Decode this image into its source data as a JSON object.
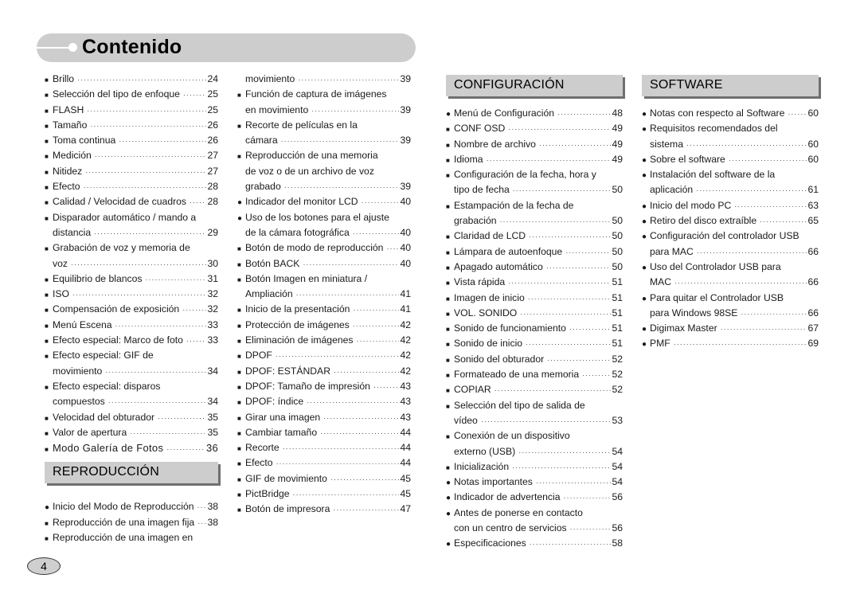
{
  "title": "Contenido",
  "page_number": "4",
  "column1": {
    "entries": [
      {
        "bullet": "square",
        "label": "Brillo",
        "page": "24"
      },
      {
        "bullet": "square",
        "label": "Selección del tipo de enfoque",
        "page": "25"
      },
      {
        "bullet": "square",
        "label": "FLASH",
        "page": "25"
      },
      {
        "bullet": "square",
        "label": "Tamaño",
        "page": "26"
      },
      {
        "bullet": "square",
        "label": "Toma continua",
        "page": "26"
      },
      {
        "bullet": "square",
        "label": "Medición",
        "page": "27"
      },
      {
        "bullet": "square",
        "label": "Nitidez",
        "page": "27"
      },
      {
        "bullet": "square",
        "label": "Efecto",
        "page": "28"
      },
      {
        "bullet": "square",
        "label": "Calidad / Velocidad de cuadros",
        "page": "28"
      },
      {
        "bullet": "square",
        "label": "Disparador automático / mando a",
        "page": ""
      },
      {
        "bullet": "",
        "label": "distancia",
        "page": "29"
      },
      {
        "bullet": "square",
        "label": "Grabación de voz y memoria de",
        "page": ""
      },
      {
        "bullet": "",
        "label": "voz",
        "page": "30"
      },
      {
        "bullet": "square",
        "label": "Equilibrio de blancos",
        "page": "31"
      },
      {
        "bullet": "square",
        "label": "ISO",
        "page": "32"
      },
      {
        "bullet": "square",
        "label": "Compensación de exposición",
        "page": "32"
      },
      {
        "bullet": "square",
        "label": "Menú Escena",
        "page": "33"
      },
      {
        "bullet": "square",
        "label": "Efecto especial: Marco de foto",
        "page": "33"
      },
      {
        "bullet": "square",
        "label": "Efecto especial: GIF de",
        "page": ""
      },
      {
        "bullet": "",
        "label": "movimiento",
        "page": "34"
      },
      {
        "bullet": "square",
        "label": "Efecto especial: disparos",
        "page": ""
      },
      {
        "bullet": "",
        "label": "compuestos",
        "page": "34"
      },
      {
        "bullet": "square",
        "label": "Velocidad del obturador",
        "page": "35"
      },
      {
        "bullet": "square",
        "label": "Valor de apertura",
        "page": "35"
      },
      {
        "bullet": "square",
        "label": "Modo Galería de Fotos",
        "page": "36"
      }
    ],
    "section_heading": "REPRODUCCIÓN",
    "section_entries": [
      {
        "bullet": "circle",
        "label": "Inicio del Modo de Reproducción",
        "page": "38"
      },
      {
        "bullet": "square",
        "label": "Reproducción de una imagen fija",
        "page": "38"
      },
      {
        "bullet": "square",
        "label": "Reproducción de una imagen en",
        "page": ""
      }
    ]
  },
  "column2": {
    "entries": [
      {
        "bullet": "",
        "label": "movimiento",
        "page": "39"
      },
      {
        "bullet": "square",
        "label": "Función de captura de imágenes",
        "page": ""
      },
      {
        "bullet": "",
        "label": "en movimiento",
        "page": "39"
      },
      {
        "bullet": "square",
        "label": "Recorte de películas en la",
        "page": ""
      },
      {
        "bullet": "",
        "label": "cámara",
        "page": "39"
      },
      {
        "bullet": "square",
        "label": "Reproducción de una memoria",
        "page": ""
      },
      {
        "bullet": "",
        "label": "de voz o de un archivo de voz",
        "page": ""
      },
      {
        "bullet": "",
        "label": "grabado",
        "page": "39"
      },
      {
        "bullet": "circle",
        "label": "Indicador del monitor LCD",
        "page": "40"
      },
      {
        "bullet": "circle",
        "label": "Uso de los botones para el ajuste",
        "page": ""
      },
      {
        "bullet": "",
        "label": "de la cámara fotográfica",
        "page": "40"
      },
      {
        "bullet": "square",
        "label": "Botón de modo de reproducción",
        "page": "40"
      },
      {
        "bullet": "square",
        "label": "Botón BACK",
        "page": "40"
      },
      {
        "bullet": "square",
        "label": "Botón Imagen en miniatura /",
        "page": ""
      },
      {
        "bullet": "",
        "label": "Ampliación",
        "page": "41"
      },
      {
        "bullet": "square",
        "label": "Inicio de la presentación",
        "page": "41"
      },
      {
        "bullet": "square",
        "label": "Protección de imágenes",
        "page": "42"
      },
      {
        "bullet": "square",
        "label": "Eliminación de imágenes",
        "page": "42"
      },
      {
        "bullet": "square",
        "label": "DPOF",
        "page": "42"
      },
      {
        "bullet": "square",
        "label": "DPOF: ESTÁNDAR",
        "page": "42"
      },
      {
        "bullet": "square",
        "label": "DPOF: Tamaño de impresión",
        "page": "43"
      },
      {
        "bullet": "square",
        "label": "DPOF: índice",
        "page": "43"
      },
      {
        "bullet": "square",
        "label": "Girar una imagen",
        "page": "43"
      },
      {
        "bullet": "square",
        "label": "Cambiar tamaño",
        "page": "44"
      },
      {
        "bullet": "square",
        "label": "Recorte",
        "page": "44"
      },
      {
        "bullet": "square",
        "label": "Efecto",
        "page": "44"
      },
      {
        "bullet": "square",
        "label": "GIF de movimiento",
        "page": "45"
      },
      {
        "bullet": "square",
        "label": "PictBridge",
        "page": "45"
      },
      {
        "bullet": "square",
        "label": "Botón de impresora",
        "page": "47"
      }
    ]
  },
  "column3": {
    "section_heading": "CONFIGURACIÓN",
    "entries": [
      {
        "bullet": "circle",
        "label": "Menú de Configuración",
        "page": "48"
      },
      {
        "bullet": "square",
        "label": "CONF OSD",
        "page": "49"
      },
      {
        "bullet": "square",
        "label": "Nombre de archivo",
        "page": "49"
      },
      {
        "bullet": "square",
        "label": "Idioma",
        "page": "49"
      },
      {
        "bullet": "square",
        "label": "Configuración de la fecha, hora y",
        "page": ""
      },
      {
        "bullet": "",
        "label": "tipo de fecha",
        "page": "50"
      },
      {
        "bullet": "square",
        "label": "Estampación de la fecha de",
        "page": ""
      },
      {
        "bullet": "",
        "label": "grabación",
        "page": "50"
      },
      {
        "bullet": "square",
        "label": "Claridad de LCD",
        "page": "50"
      },
      {
        "bullet": "square",
        "label": "Lámpara de autoenfoque",
        "page": "50"
      },
      {
        "bullet": "square",
        "label": "Apagado automático",
        "page": "50"
      },
      {
        "bullet": "square",
        "label": "Vista rápida",
        "page": "51"
      },
      {
        "bullet": "square",
        "label": "Imagen de inicio",
        "page": "51"
      },
      {
        "bullet": "square",
        "label": "VOL. SONIDO",
        "page": "51"
      },
      {
        "bullet": "square",
        "label": "Sonido de funcionamiento",
        "page": "51"
      },
      {
        "bullet": "square",
        "label": "Sonido de inicio",
        "page": "51"
      },
      {
        "bullet": "square",
        "label": "Sonido del obturador",
        "page": "52"
      },
      {
        "bullet": "square",
        "label": "Formateado de una memoria",
        "page": "52"
      },
      {
        "bullet": "square",
        "label": "COPIAR",
        "page": "52"
      },
      {
        "bullet": "square",
        "label": "Selección del tipo de salida de",
        "page": ""
      },
      {
        "bullet": "",
        "label": "vídeo",
        "page": "53"
      },
      {
        "bullet": "square",
        "label": "Conexión de un dispositivo",
        "page": ""
      },
      {
        "bullet": "",
        "label": "externo (USB)",
        "page": "54"
      },
      {
        "bullet": "square",
        "label": "Inicialización",
        "page": "54"
      },
      {
        "bullet": "circle",
        "label": "Notas importantes",
        "page": "54"
      },
      {
        "bullet": "circle",
        "label": "Indicador de advertencia",
        "page": "56"
      },
      {
        "bullet": "circle",
        "label": "Antes de ponerse en contacto",
        "page": ""
      },
      {
        "bullet": "",
        "label": "con un centro de servicios",
        "page": "56"
      },
      {
        "bullet": "circle",
        "label": "Especificaciones",
        "page": "58"
      }
    ]
  },
  "column4": {
    "section_heading": "SOFTWARE",
    "entries": [
      {
        "bullet": "circle",
        "label": "Notas con respecto al Software",
        "page": "60"
      },
      {
        "bullet": "circle",
        "label": "Requisitos recomendados del",
        "page": ""
      },
      {
        "bullet": "",
        "label": "sistema",
        "page": "60"
      },
      {
        "bullet": "circle",
        "label": "Sobre el software",
        "page": "60"
      },
      {
        "bullet": "circle",
        "label": "Instalación del software de la",
        "page": ""
      },
      {
        "bullet": "",
        "label": "aplicación",
        "page": "61"
      },
      {
        "bullet": "circle",
        "label": "Inicio del modo PC",
        "page": "63"
      },
      {
        "bullet": "circle",
        "label": "Retiro del disco extraíble",
        "page": "65"
      },
      {
        "bullet": "circle",
        "label": "Configuración del controlador USB",
        "page": ""
      },
      {
        "bullet": "",
        "label": "para MAC",
        "page": "66"
      },
      {
        "bullet": "circle",
        "label": "Uso del Controlador USB para",
        "page": ""
      },
      {
        "bullet": "",
        "label": "MAC",
        "page": "66"
      },
      {
        "bullet": "circle",
        "label": "Para quitar el Controlador USB",
        "page": ""
      },
      {
        "bullet": "",
        "label": "para Windows 98SE",
        "page": "66"
      },
      {
        "bullet": "circle",
        "label": "Digimax Master",
        "page": "67"
      },
      {
        "bullet": "circle",
        "label": "PMF",
        "page": "69"
      }
    ]
  }
}
